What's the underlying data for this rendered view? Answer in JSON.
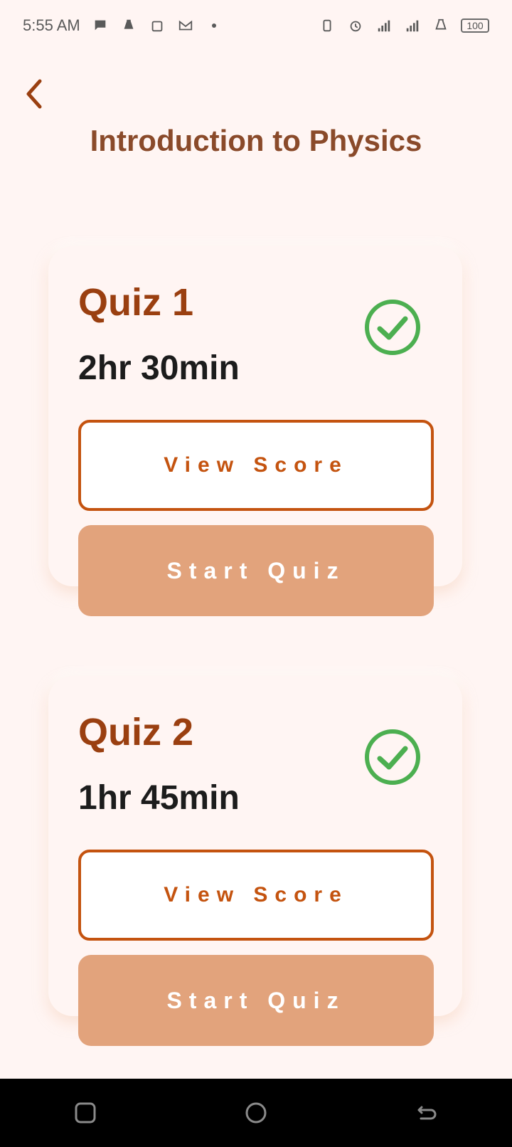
{
  "status_bar": {
    "time": "5:55 AM",
    "left_icons": [
      "chat-bubble-icon",
      "lab-flask-icon",
      "shopping-bag-icon",
      "gmail-icon",
      "dot-icon"
    ],
    "right_icons": [
      "vibrate-icon",
      "alarm-icon",
      "signal-bars-icon",
      "signal-bars-icon",
      "flask-icon"
    ],
    "battery": "100"
  },
  "header": {
    "title": "Introduction to Physics",
    "back_icon": "chevron-left-icon"
  },
  "quizzes": [
    {
      "title": "Quiz 1",
      "duration": "2hr 30min",
      "completed": true,
      "view_score_label": "View Score",
      "start_label": "Start Quiz"
    },
    {
      "title": "Quiz 2",
      "duration": "1hr 45min",
      "completed": true,
      "view_score_label": "View Score",
      "start_label": "Start Quiz"
    }
  ],
  "nav_bar": {
    "buttons": [
      "recents-square-icon",
      "home-circle-icon",
      "back-arrow-icon"
    ]
  },
  "colors": {
    "background": "#fff5f3",
    "title": "#8a4a2a",
    "quiz_title": "#9a3f10",
    "accent": "#c4530f",
    "start_button": "#e2a37c",
    "check": "#4caf50"
  }
}
